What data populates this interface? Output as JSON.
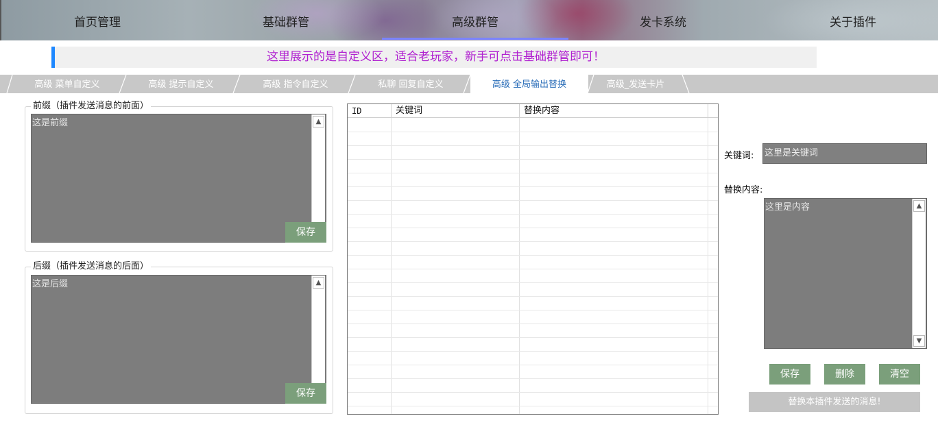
{
  "topnav": {
    "items": [
      {
        "label": "首页管理"
      },
      {
        "label": "基础群管"
      },
      {
        "label": "高级群管"
      },
      {
        "label": "发卡系统"
      },
      {
        "label": "关于插件"
      }
    ],
    "active_index": 2
  },
  "info": {
    "text": "这里展示的是自定义区，适合老玩家，新手可点击基础群管即可！"
  },
  "subtabs": {
    "items": [
      {
        "label": "高级 菜单自定义"
      },
      {
        "label": "高级 提示自定义"
      },
      {
        "label": "高级 指令自定义"
      },
      {
        "label": "私聊 回复自定义"
      },
      {
        "label": "高级 全局输出替换"
      },
      {
        "label": "高级_发送卡片"
      }
    ],
    "active_index": 4
  },
  "prefix": {
    "title": "前缀（插件发送消息的前面）",
    "value": "这是前缀",
    "save_label": "保存"
  },
  "suffix": {
    "title": "后缀（插件发送消息的后面）",
    "value": "这是后缀",
    "save_label": "保存"
  },
  "table": {
    "columns": [
      "ID",
      "关键词",
      "替换内容"
    ],
    "rows": []
  },
  "replace_panel": {
    "keyword_label": "关键词:",
    "keyword_value": "这里是关键词",
    "content_label": "替换内容:",
    "content_value": "这里是内容",
    "save_label": "保存",
    "delete_label": "删除",
    "clear_label": "清空",
    "hint_label": "替换本插件发送的消息!"
  },
  "colors": {
    "accent_blue": "#1e88ff",
    "info_text": "#b020d0",
    "button_green": "#7b9f7b",
    "active_tab_text": "#2a6db8",
    "textarea_gray": "#7d7d7d"
  }
}
